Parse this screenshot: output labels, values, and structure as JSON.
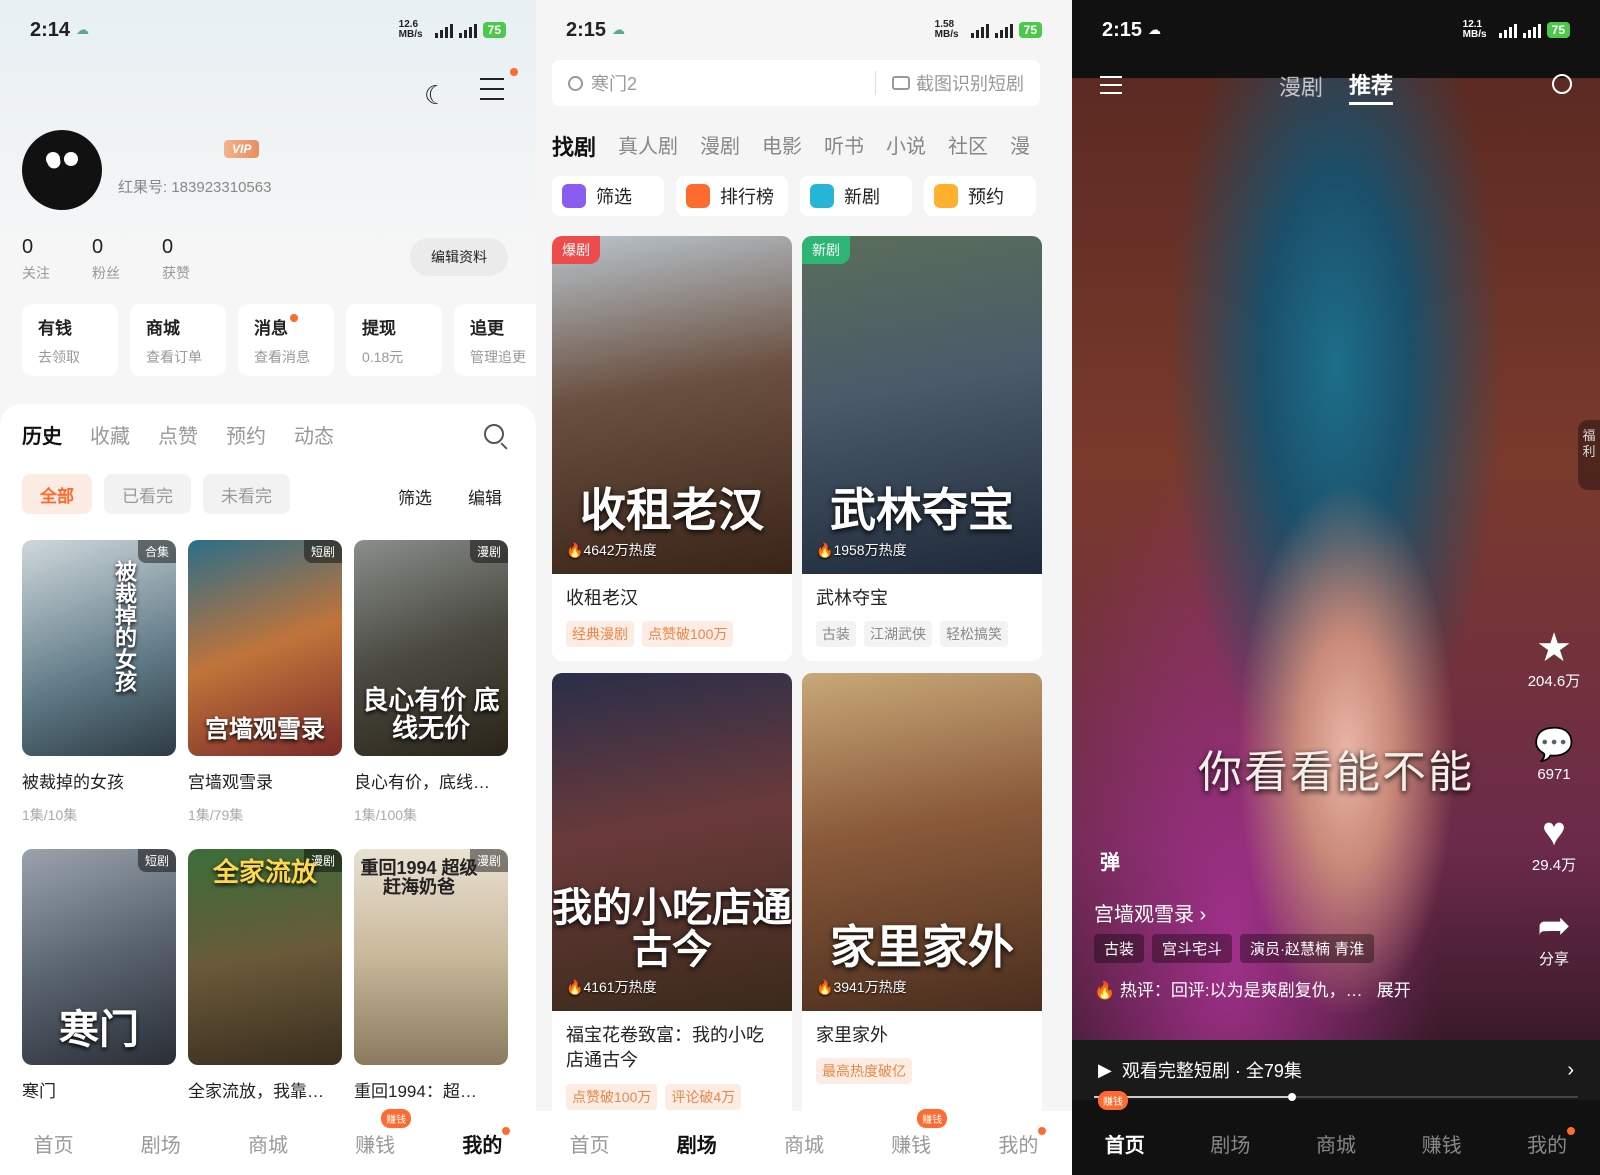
{
  "p1": {
    "status": {
      "time": "2:14",
      "speed": "12.6 MB/s",
      "battery": "75"
    },
    "vip": "VIP",
    "uid": "红果号: 183923310563",
    "stats": [
      {
        "n": "0",
        "l": "关注"
      },
      {
        "n": "0",
        "l": "粉丝"
      },
      {
        "n": "0",
        "l": "获赞"
      }
    ],
    "edit": "编辑资料",
    "quick": [
      {
        "t": "有钱",
        "s": "去领取"
      },
      {
        "t": "商城",
        "s": "查看订单"
      },
      {
        "t": "消息",
        "s": "查看消息"
      },
      {
        "t": "提现",
        "s": "0.18元"
      },
      {
        "t": "追更",
        "s": "管理追更"
      }
    ],
    "tabs": [
      "历史",
      "收藏",
      "点赞",
      "预约",
      "动态"
    ],
    "filters": [
      "全部",
      "已看完",
      "未看完"
    ],
    "filter_btn": "筛选",
    "edit_btn": "编辑",
    "items": [
      {
        "tag": "合集",
        "title": "被裁掉的女孩",
        "sub": "1集/10集",
        "poster": "被裁掉的女孩"
      },
      {
        "tag": "短剧",
        "title": "宫墙观雪录",
        "sub": "1集/79集",
        "poster": "宫墙观雪录"
      },
      {
        "tag": "漫剧",
        "title": "良心有价，底线…",
        "sub": "1集/100集",
        "poster": "良心有价 底线无价"
      },
      {
        "tag": "短剧",
        "title": "寒门",
        "sub": "",
        "poster": "寒门"
      },
      {
        "tag": "漫剧",
        "title": "全家流放，我靠…",
        "sub": "",
        "poster": "全家流放"
      },
      {
        "tag": "漫剧",
        "title": "重回1994：超…",
        "sub": "",
        "poster": "重回1994 超级赶海奶爸"
      }
    ],
    "nav": [
      "首页",
      "剧场",
      "商城",
      "赚钱",
      "我的"
    ],
    "earn_badge": "赚钱"
  },
  "p2": {
    "status": {
      "time": "2:15",
      "speed": "1.58 MB/s",
      "battery": "75"
    },
    "search_placeholder": "寒门2",
    "search_cam": "截图识别短剧",
    "tabs": [
      "找剧",
      "真人剧",
      "漫剧",
      "电影",
      "听书",
      "小说",
      "社区",
      "漫"
    ],
    "cats": [
      {
        "l": "筛选",
        "c": "#8a5cf0"
      },
      {
        "l": "排行榜",
        "c": "#ff6a2f"
      },
      {
        "l": "新剧",
        "c": "#26b5d8"
      },
      {
        "l": "预约",
        "c": "#ffb02e"
      }
    ],
    "cards": [
      {
        "ttag": "爆剧",
        "ttagc": "#ee4b4b",
        "poster": "收租老汉",
        "heat": "4642万热度",
        "title": "收租老汉",
        "tags": [
          {
            "t": "经典漫剧",
            "hot": true
          },
          {
            "t": "点赞破100万",
            "hot": true
          }
        ]
      },
      {
        "ttag": "新剧",
        "ttagc": "#2bb673",
        "poster": "武林夺宝",
        "heat": "1958万热度",
        "title": "武林夺宝",
        "tags": [
          {
            "t": "古装",
            "hot": false
          },
          {
            "t": "江湖武侠",
            "hot": false
          },
          {
            "t": "轻松搞笑",
            "hot": false
          }
        ]
      },
      {
        "ttag": "",
        "ttagc": "",
        "poster": "我的小吃店通古今",
        "heat": "4161万热度",
        "title": "福宝花卷致富：我的小吃店通古今",
        "tags": [
          {
            "t": "点赞破100万",
            "hot": true
          },
          {
            "t": "评论破4万",
            "hot": true
          }
        ]
      },
      {
        "ttag": "",
        "ttagc": "",
        "poster": "家里家外",
        "heat": "3941万热度",
        "title": "家里家外",
        "tags": [
          {
            "t": "最高热度破亿",
            "hot": true
          }
        ]
      }
    ],
    "nav": [
      "首页",
      "剧场",
      "商城",
      "赚钱",
      "我的"
    ],
    "earn_badge": "赚钱"
  },
  "p3": {
    "status": {
      "time": "2:15",
      "speed": "12.1 MB/s",
      "battery": "75"
    },
    "tabs": [
      "漫剧",
      "推荐"
    ],
    "subtitle": "你看看能不能",
    "actions": [
      {
        "ic": "★",
        "n": "204.6万"
      },
      {
        "ic": "💬",
        "n": "6971"
      },
      {
        "ic": "♥",
        "n": "29.4万"
      },
      {
        "ic": "➦",
        "n": "分享"
      }
    ],
    "fuli": "福利",
    "dan": "弹",
    "show": "宫墙观雪录 ›",
    "tags": [
      "古装",
      "宫斗宅斗",
      "演员·赵慧楠 青淮"
    ],
    "hot": "热评：回评:以为是爽剧复仇，…",
    "expand": "展开",
    "watch": "观看完整短剧 · 全79集",
    "nav": [
      "首页",
      "剧场",
      "商城",
      "赚钱",
      "我的"
    ],
    "earn_badge": "赚钱"
  }
}
